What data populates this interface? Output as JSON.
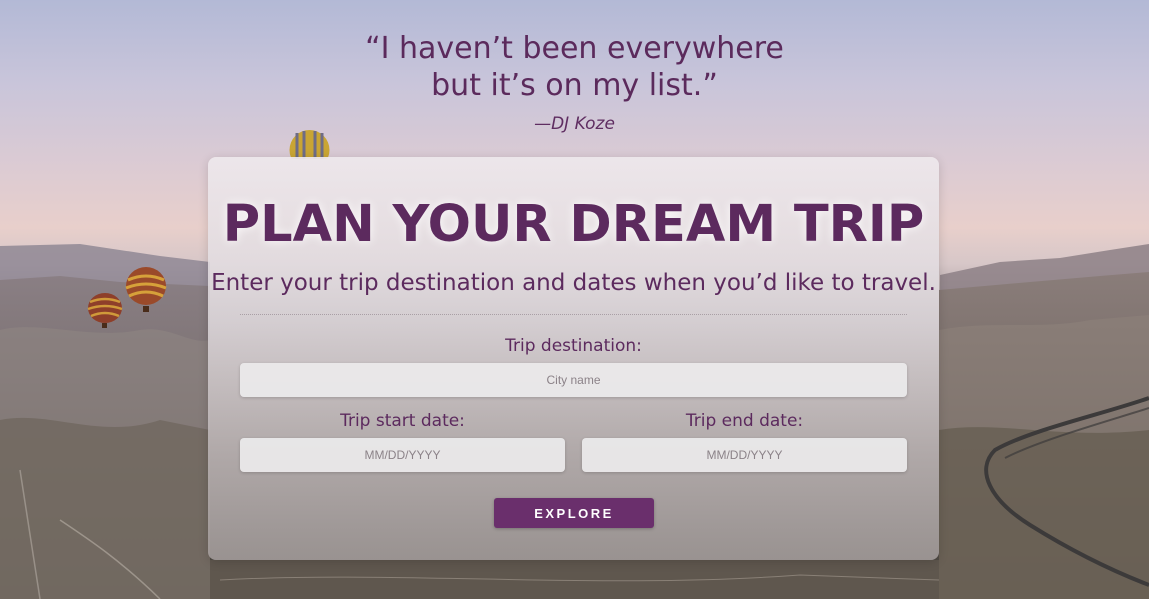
{
  "quote": {
    "line1": "“I haven’t been everywhere",
    "line2": "but it’s on my list.”",
    "author": "—DJ Koze"
  },
  "card": {
    "title": "PLAN YOUR DREAM TRIP",
    "subtitle": "Enter your trip destination and dates when you’d like to travel."
  },
  "form": {
    "destination_label": "Trip destination:",
    "destination_placeholder": "City name",
    "start_label": "Trip start date:",
    "start_placeholder": "MM/DD/YYYY",
    "end_label": "Trip end date:",
    "end_placeholder": "MM/DD/YYYY",
    "explore_label": "EXPLORE"
  },
  "colors": {
    "accent": "#6a2f6c",
    "text": "#5c2a5e"
  }
}
